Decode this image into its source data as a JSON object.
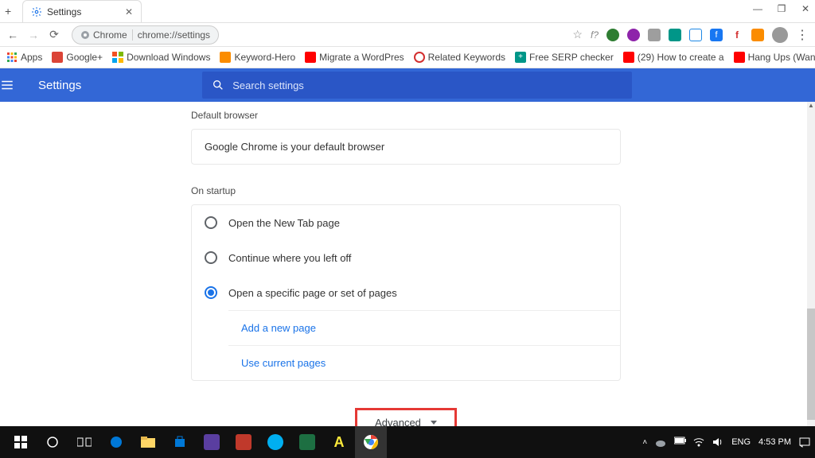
{
  "browser": {
    "tab_title": "Settings",
    "omnibox_label": "Chrome",
    "url": "chrome://settings",
    "menu_dots": "⋮"
  },
  "toolbar_icons": {
    "star": "☆",
    "f_question": "f?"
  },
  "bookmarks": [
    {
      "label": "Apps",
      "color": "sq-blue"
    },
    {
      "label": "Google+",
      "color": "sq-gplus"
    },
    {
      "label": "Download Windows",
      "color": "sq-gray"
    },
    {
      "label": "Keyword-Hero",
      "color": "sq-orange"
    },
    {
      "label": "Migrate a WordPres",
      "color": "sq-yt"
    },
    {
      "label": "Related Keywords",
      "color": "sq-red"
    },
    {
      "label": "Free SERP checker",
      "color": "sq-teal"
    },
    {
      "label": "(29) How to create a",
      "color": "sq-yt"
    },
    {
      "label": "Hang Ups (Want You",
      "color": "sq-yt"
    }
  ],
  "bookmarks_overflow": "»",
  "settings": {
    "app_title": "Settings",
    "search_placeholder": "Search settings",
    "default_browser": {
      "heading": "Default browser",
      "status": "Google Chrome is your default browser"
    },
    "on_startup": {
      "heading": "On startup",
      "options": [
        {
          "label": "Open the New Tab page",
          "selected": false
        },
        {
          "label": "Continue where you left off",
          "selected": false
        },
        {
          "label": "Open a specific page or set of pages",
          "selected": true
        }
      ],
      "links": {
        "add_page": "Add a new page",
        "use_current": "Use current pages"
      }
    },
    "advanced_label": "Advanced"
  },
  "win_controls": {
    "min": "—",
    "max": "❐",
    "close": "✕"
  },
  "taskbar": {
    "lang": "ENG",
    "time": "4:53 PM"
  }
}
